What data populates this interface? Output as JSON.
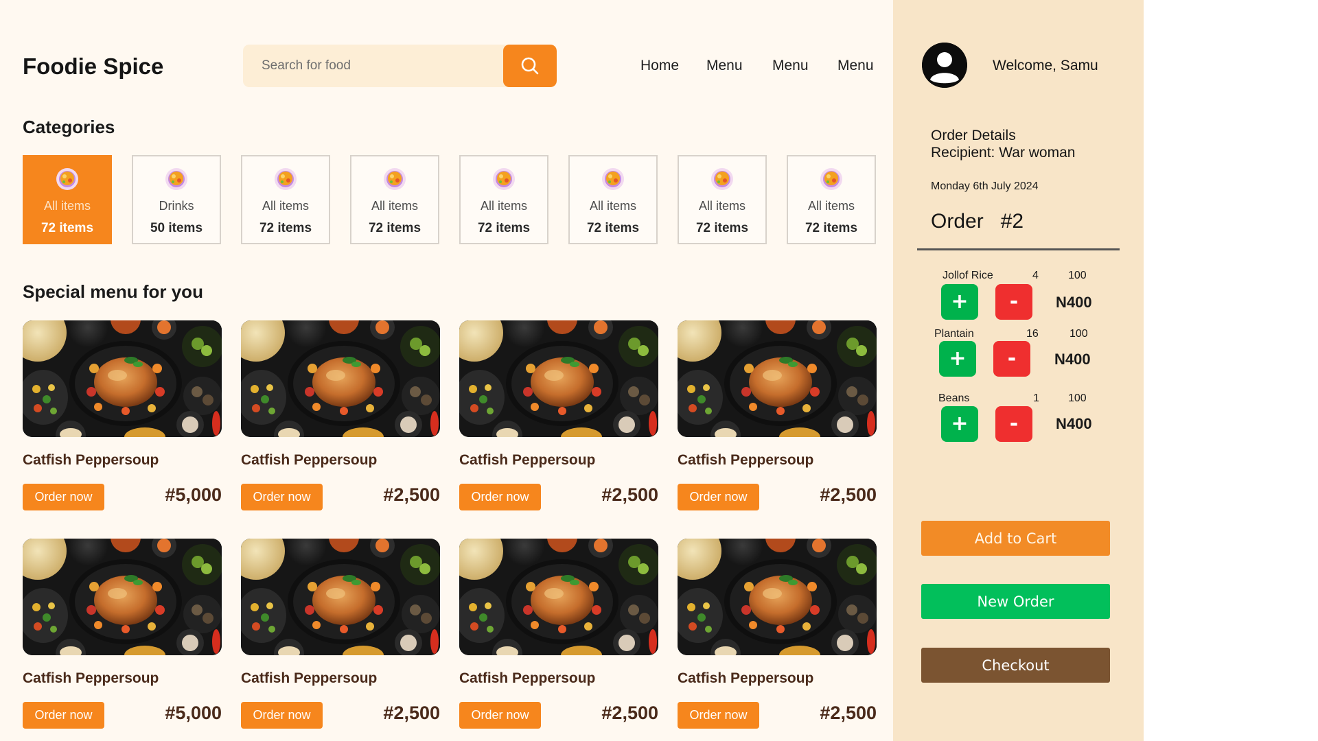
{
  "app": {
    "brand": "Foodie Spice"
  },
  "search": {
    "placeholder": "Search for food",
    "icon": "search-icon"
  },
  "nav": {
    "items": [
      "Home",
      "Menu",
      "Menu",
      "Menu"
    ]
  },
  "categories": {
    "title": "Categories",
    "items": [
      {
        "name": "All items",
        "count": "72 items",
        "active": true
      },
      {
        "name": "Drinks",
        "count": "50 items",
        "active": false
      },
      {
        "name": "All items",
        "count": "72 items",
        "active": false
      },
      {
        "name": "All items",
        "count": "72 items",
        "active": false
      },
      {
        "name": "All items",
        "count": "72 items",
        "active": false
      },
      {
        "name": "All items",
        "count": "72 items",
        "active": false
      },
      {
        "name": "All items",
        "count": "72 items",
        "active": false
      },
      {
        "name": "All items",
        "count": "72 items",
        "active": false
      }
    ]
  },
  "special": {
    "title": "Special menu for you",
    "order_label": "Order now",
    "cards": [
      {
        "title": "Catfish Peppersoup",
        "price": "#5,000"
      },
      {
        "title": "Catfish Peppersoup",
        "price": "#2,500"
      },
      {
        "title": "Catfish Peppersoup",
        "price": "#2,500"
      },
      {
        "title": "Catfish Peppersoup",
        "price": "#2,500"
      },
      {
        "title": "Catfish Peppersoup",
        "price": "#5,000"
      },
      {
        "title": "Catfish Peppersoup",
        "price": "#2,500"
      },
      {
        "title": "Catfish Peppersoup",
        "price": "#2,500"
      },
      {
        "title": "Catfish Peppersoup",
        "price": "#2,500"
      }
    ]
  },
  "panel": {
    "welcome": "Welcome, Samu",
    "order_details": "Order Details",
    "recipient": "Recipient: War woman",
    "date": "Monday 6th July 2024",
    "order_number": "Order   #2",
    "items": [
      {
        "name": "Jollof Rice",
        "qty": "4",
        "unit": "100",
        "total": "N400"
      },
      {
        "name": "Plantain",
        "qty": "16",
        "unit": "100",
        "total": "N400"
      },
      {
        "name": "Beans",
        "qty": "1",
        "unit": "100",
        "total": "N400"
      }
    ],
    "plus_label": "+",
    "minus_label": "-",
    "add_to_cart": "Add to Cart",
    "new_order": "New Order",
    "checkout": "Checkout"
  },
  "colors": {
    "accent": "#f6861d",
    "panel_bg": "#f8e5c8",
    "main_bg": "#fff9f1",
    "plus": "#00b24c",
    "minus": "#ef2f2f",
    "checkout": "#7b5431",
    "new_order": "#02bf5b"
  }
}
